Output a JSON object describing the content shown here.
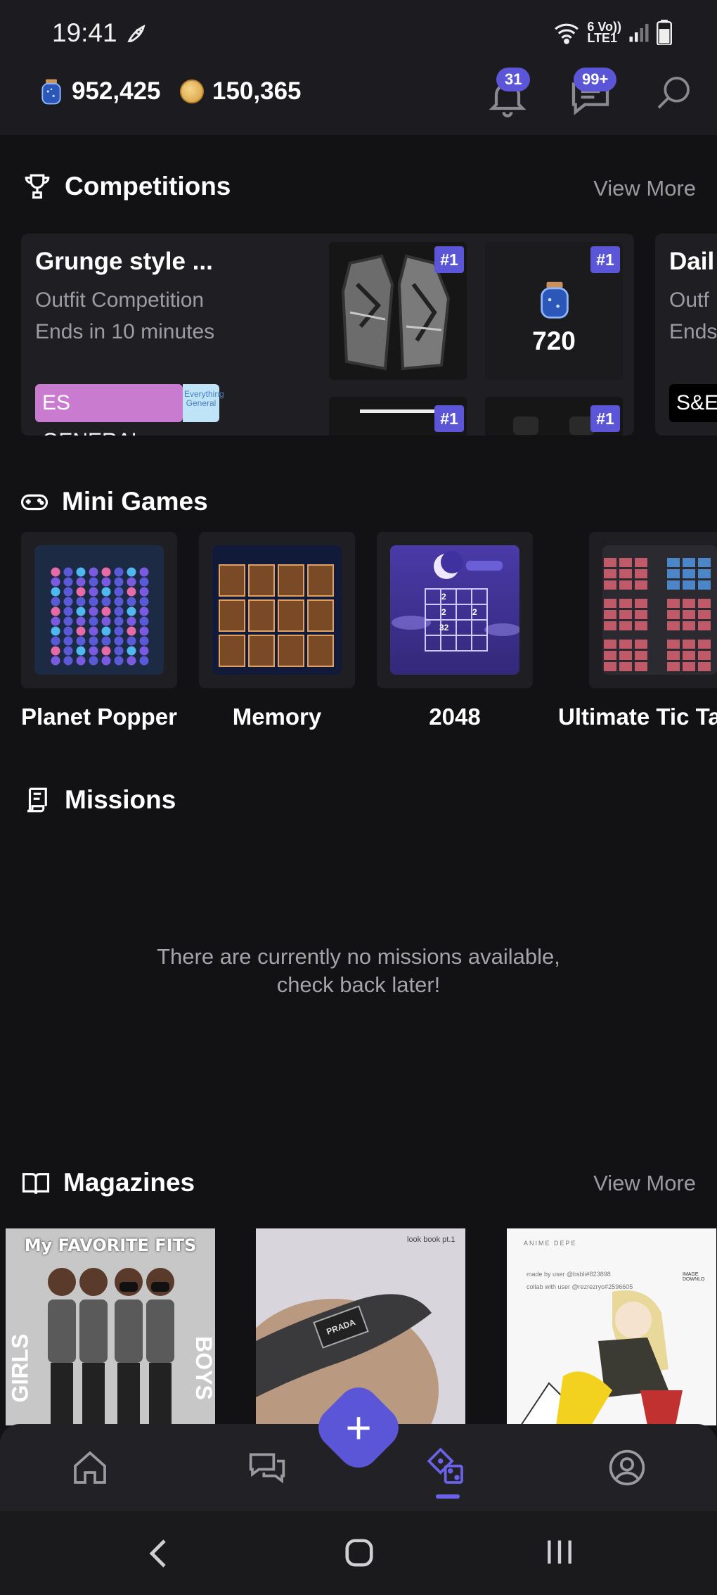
{
  "status": {
    "time": "19:41",
    "network_top": "6 Vo))",
    "network_bottom": "LTE1"
  },
  "header": {
    "gems": "952,425",
    "coins": "150,365",
    "notifications_badge": "31",
    "messages_badge": "99+"
  },
  "competitions": {
    "title": "Competitions",
    "view_more": "View More",
    "cards": [
      {
        "name": "Grunge style ...",
        "type": "Outfit Competition",
        "ends": "Ends in 10 minutes",
        "tag": "ES GENERAL",
        "tag_mini": "Everything General",
        "prize_value": "720",
        "ranks": [
          "#1",
          "#1",
          "#1",
          "#1"
        ]
      },
      {
        "name": "Dail",
        "type": "Outf",
        "ends": "Ends",
        "tag": "S&E"
      }
    ]
  },
  "mini_games": {
    "title": "Mini Games",
    "items": [
      {
        "label": "Planet Popper",
        "icon": "planet-popper"
      },
      {
        "label": "Memory",
        "icon": "memory"
      },
      {
        "label": "2048",
        "icon": "2048"
      },
      {
        "label": "Ultimate Tic Ta",
        "icon": "tic-tac-toe"
      }
    ],
    "tile_2048_numbers": [
      "2",
      "2",
      "2",
      "32"
    ]
  },
  "missions": {
    "title": "Missions",
    "empty_line1": "There are currently no missions available,",
    "empty_line2": "check back later!"
  },
  "magazines": {
    "title": "Magazines",
    "view_more": "View More",
    "items": [
      {
        "cover_text": "My FAVORITE FITS",
        "left_text": "GIRLS",
        "right_text": "BOYS"
      },
      {
        "cover_text": "look book pt.1",
        "brand": "PRADA"
      },
      {
        "cover_text": "ANIME DEPE",
        "line1": "made by user @bsbli#823898",
        "line2": "collab with user @rezrezryo#2596605",
        "side_text": "IMAGE DOWNLO"
      }
    ]
  },
  "colors": {
    "accent": "#5b55d8",
    "background": "#121214",
    "card": "#1f1f23",
    "tag_pink": "#c97bd0"
  }
}
